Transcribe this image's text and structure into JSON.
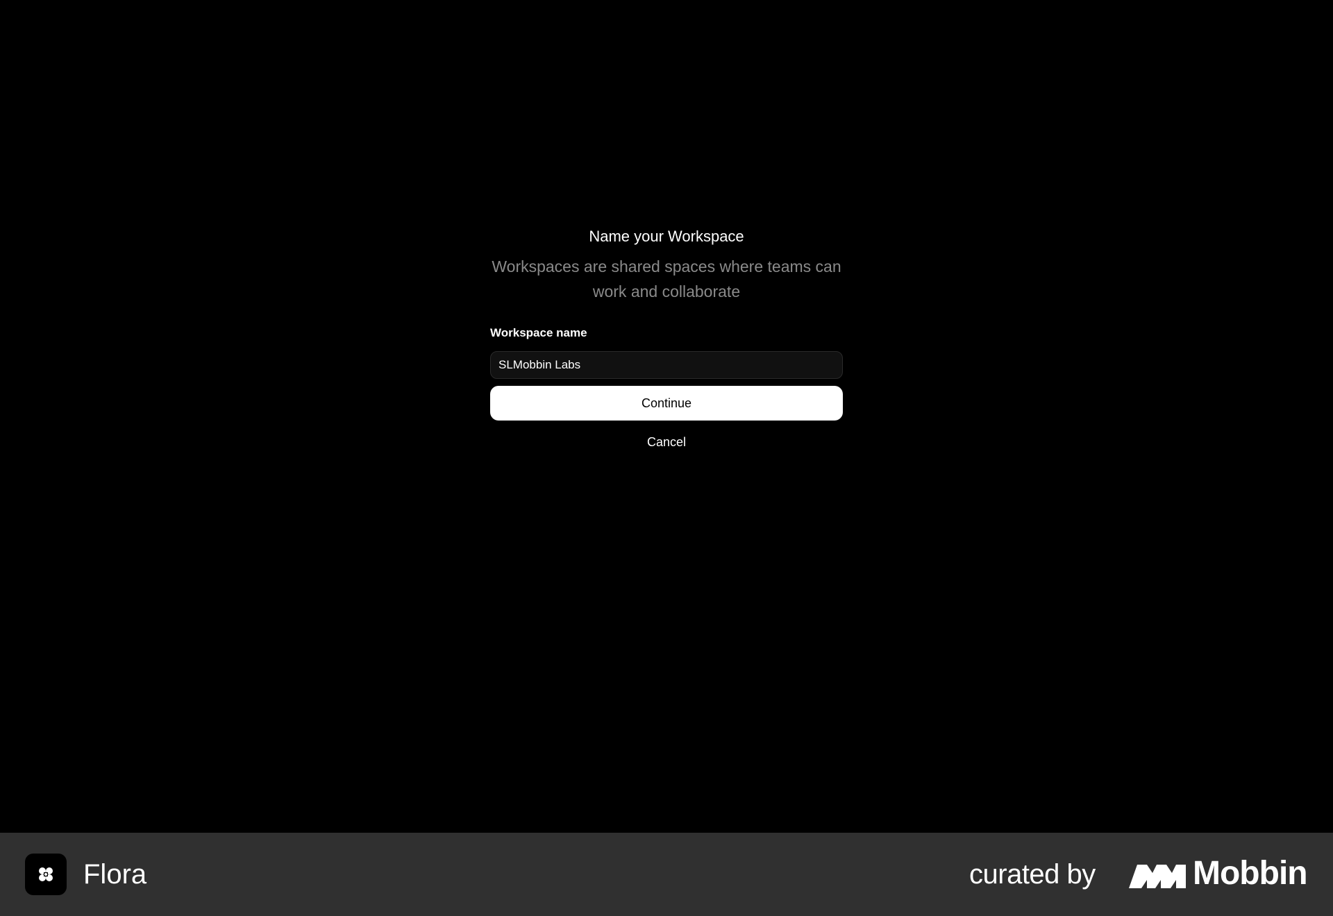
{
  "dialog": {
    "title": "Name your Workspace",
    "subtitle": "Workspaces are shared spaces where teams can work and collaborate",
    "field_label": "Workspace name",
    "field_value": "SLMobbin Labs",
    "continue_label": "Continue",
    "cancel_label": "Cancel"
  },
  "footer": {
    "app_name": "Flora",
    "app_icon": "flora-logo-icon",
    "curated_label": "curated by",
    "brand_name": "Mobbin",
    "brand_icon": "mobbin-logo-icon"
  },
  "colors": {
    "background": "#000000",
    "footer_background": "#303030",
    "subtitle_text": "#8a8a8a",
    "input_background": "#111111",
    "button_background": "#ffffff"
  }
}
